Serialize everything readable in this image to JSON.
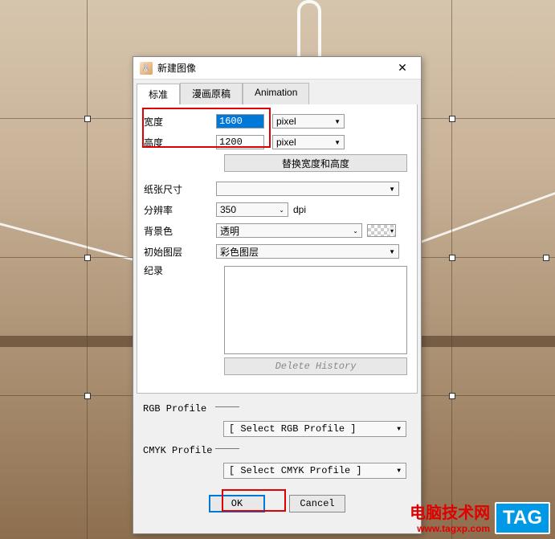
{
  "dialog": {
    "title": "新建图像",
    "tabs": [
      "标准",
      "漫画原稿",
      "Animation"
    ],
    "active_tab": 0,
    "width": {
      "label": "宽度",
      "value": "1600",
      "unit": "pixel"
    },
    "height": {
      "label": "高度",
      "value": "1200",
      "unit": "pixel"
    },
    "swap_btn": "替换宽度和高度",
    "paper_size": {
      "label": "纸张尺寸",
      "value": ""
    },
    "dpi": {
      "label": "分辨率",
      "value": "350",
      "unit": "dpi"
    },
    "bg_color": {
      "label": "背景色",
      "value": "透明"
    },
    "init_layer": {
      "label": "初始图层",
      "value": "彩色图层"
    },
    "history_label": "纪录",
    "delete_history": "Delete History",
    "rgb_profile": {
      "label": "RGB Profile",
      "value": "[ Select RGB Profile ]"
    },
    "cmyk_profile": {
      "label": "CMYK Profile",
      "value": "[ Select CMYK Profile ]"
    },
    "ok": "OK",
    "cancel": "Cancel"
  },
  "watermark": {
    "line1": "电脑技术网",
    "line2": "www.tagxp.com",
    "tag": "TAG"
  }
}
